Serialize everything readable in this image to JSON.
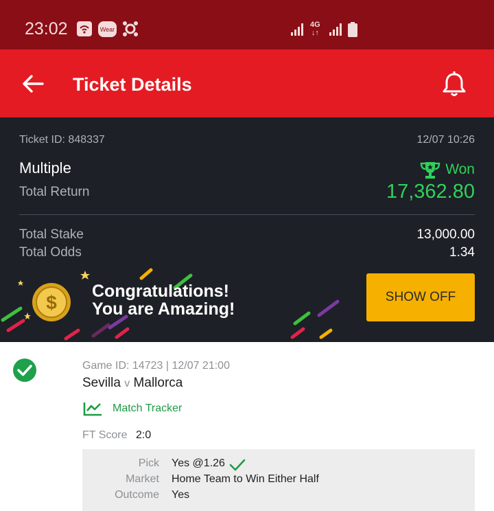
{
  "status_bar": {
    "time": "23:02",
    "wear_badge": "Wear",
    "network": "4G"
  },
  "header": {
    "title": "Ticket Details"
  },
  "ticket": {
    "id_label": "Ticket ID: 848337",
    "datetime": "12/07 10:26",
    "bet_type": "Multiple",
    "status": "Won",
    "total_return_label": "Total Return",
    "total_return": "17,362.80",
    "total_stake_label": "Total Stake",
    "total_stake": "13,000.00",
    "total_odds_label": "Total Odds",
    "total_odds": "1.34"
  },
  "banner": {
    "line1": "Congratulations!",
    "line2": "You are Amazing!",
    "button": "SHOW OFF"
  },
  "game": {
    "info": "Game ID: 14723 | 12/07 21:00",
    "home": "Sevilla",
    "vs": "v",
    "away": "Mallorca",
    "tracker": "Match Tracker",
    "ft_label": "FT Score",
    "ft_score": "2:0",
    "pick_label": "Pick",
    "pick_value": "Yes @1.26",
    "market_label": "Market",
    "market_value": "Home Team to Win Either Half",
    "outcome_label": "Outcome",
    "outcome_value": "Yes"
  },
  "colors": {
    "status_bar": "#8a0e16",
    "app_bar": "#e41b23",
    "card_bg": "#1d2026",
    "won_green": "#2fd15a",
    "button_yellow": "#f5b000"
  }
}
